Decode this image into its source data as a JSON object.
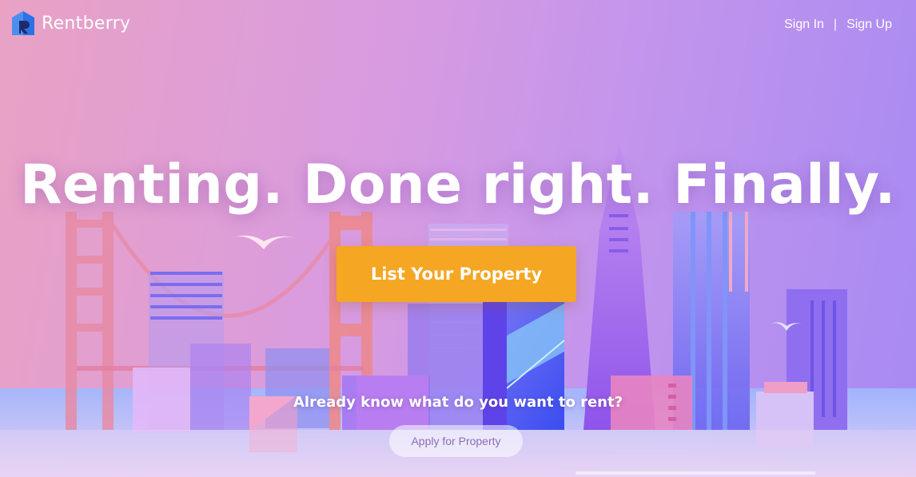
{
  "brand": {
    "name": "Rentberry",
    "logo_icon": "house-logo-icon"
  },
  "header": {
    "sign_in": "Sign In",
    "separator": "|",
    "sign_up": "Sign Up"
  },
  "hero": {
    "headline": "Renting. Done right. Finally.",
    "cta_label": "List Your Property",
    "subtext": "Already know what do you want to rent?",
    "secondary_label": "Apply for Property"
  },
  "colors": {
    "cta": "#f5a623",
    "bg_left": "#e9a2c4",
    "bg_mid": "#d89be0",
    "bg_right": "#a78af3",
    "logo_blue": "#2b72e6"
  }
}
